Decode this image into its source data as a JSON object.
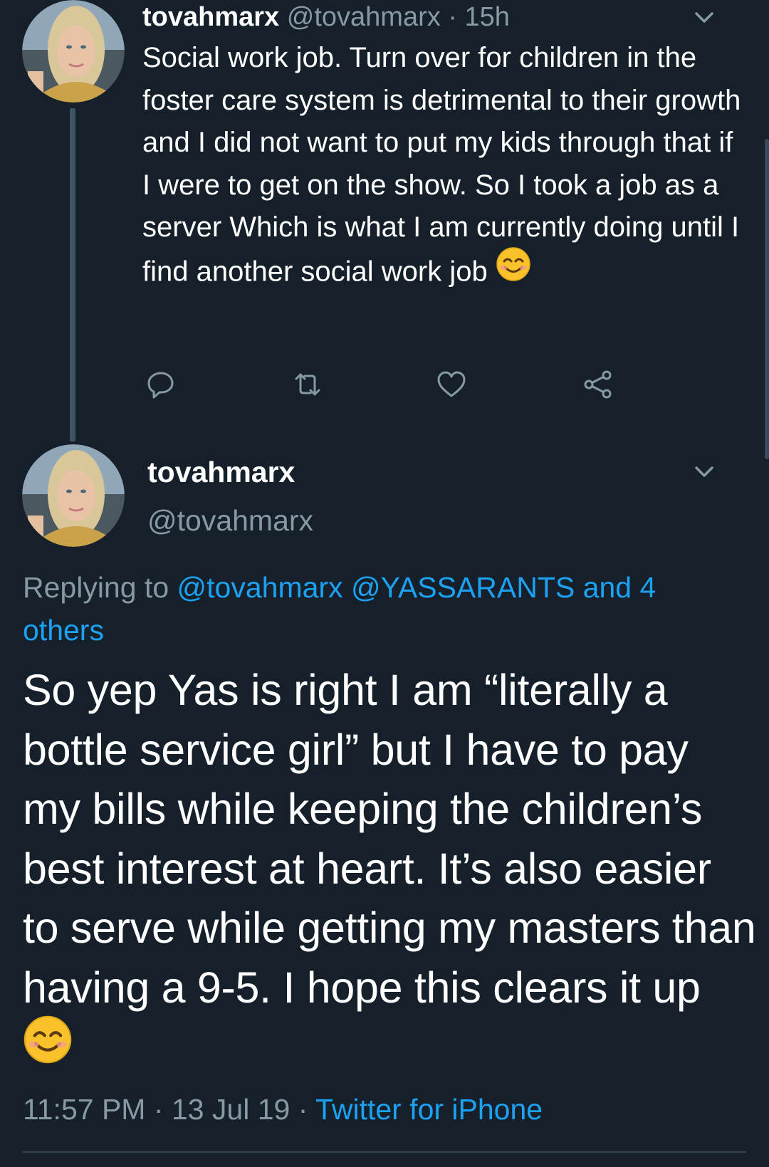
{
  "colors": {
    "background": "#15202b",
    "text_primary": "#ffffff",
    "text_secondary": "#8899a6",
    "link": "#1da1f2",
    "thread_line": "#3d5466"
  },
  "tweet_1": {
    "display_name": "tovahmarx",
    "handle": "@tovahmarx",
    "separator": "·",
    "time_ago": "15h",
    "text": "Social work job. Turn over for children in the foster care system is detrimental to their growth and I did not want to put my kids through that if I were to get on the show. So I took a job as a server Which is what I am currently doing until I find another social work job",
    "emoji": "smiling-face-emoji",
    "avatar": "profile-photo",
    "menu_icon": "chevron-down-icon",
    "actions": [
      "reply-icon",
      "retweet-icon",
      "like-icon",
      "share-icon"
    ]
  },
  "tweet_2": {
    "display_name": "tovahmarx",
    "handle": "@tovahmarx",
    "avatar": "profile-photo",
    "menu_icon": "chevron-down-icon",
    "replying_prefix": "Replying to",
    "reply_user_1": "@tovahmarx",
    "reply_user_2": "@YASSARANTS",
    "reply_others": "and 4 others",
    "text": "So yep Yas is right I am “literally a bottle service girl” but I have to pay my bills while keeping the children’s best interest at heart. It’s also easier to serve while getting my masters than having a 9-5. I hope this clears it up",
    "emoji": "smiling-face-emoji",
    "time": "11:57 PM",
    "separator": "·",
    "date": "13 Jul 19",
    "source": "Twitter for iPhone"
  }
}
